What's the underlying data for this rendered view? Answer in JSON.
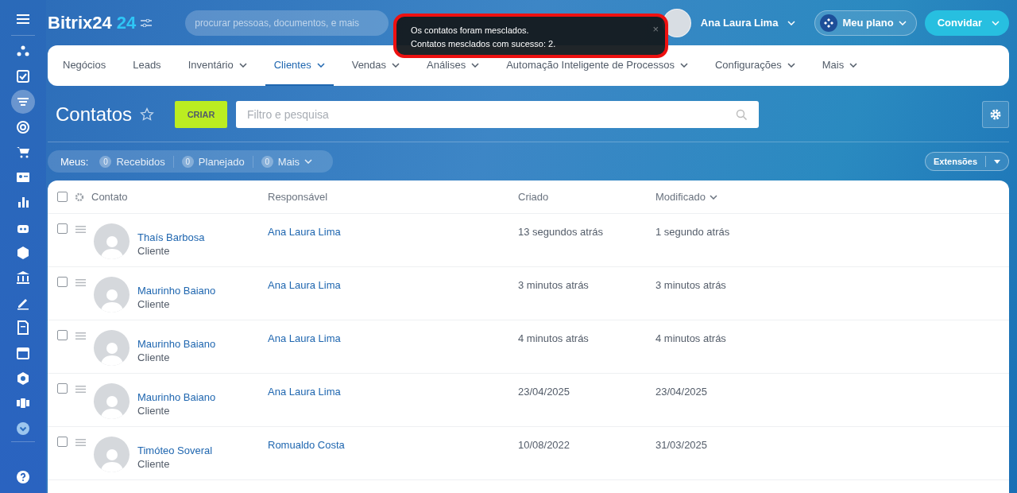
{
  "header": {
    "logo": "Bitrix24",
    "logo_badge": "24",
    "search_placeholder": "procurar pessoas, documentos, e mais",
    "user_name": "Ana Laura Lima",
    "plan_button": "Meu plano",
    "invite_button": "Convidar"
  },
  "toast": {
    "lines": [
      "Os contatos foram mesclados.",
      "Contatos mesclados com sucesso: 2."
    ],
    "close": "×"
  },
  "sidebar": {
    "items": [
      {
        "kind": "feed",
        "selected": false
      },
      {
        "kind": "tasks",
        "selected": false
      },
      {
        "kind": "filter",
        "selected": true
      },
      {
        "kind": "target",
        "selected": false
      },
      {
        "kind": "cart",
        "selected": false
      },
      {
        "kind": "card",
        "selected": false
      },
      {
        "kind": "chart",
        "selected": false
      },
      {
        "kind": "robot",
        "selected": false
      },
      {
        "kind": "box",
        "selected": false
      },
      {
        "kind": "bank",
        "selected": false
      },
      {
        "kind": "pen",
        "selected": false
      },
      {
        "kind": "doc",
        "selected": false
      },
      {
        "kind": "calendar",
        "selected": false
      },
      {
        "kind": "shield",
        "selected": false
      },
      {
        "kind": "sites",
        "selected": false
      },
      {
        "kind": "more",
        "selected": false
      }
    ]
  },
  "nav": [
    {
      "label": "Negócios",
      "selected": false,
      "dropdown": false
    },
    {
      "label": "Leads",
      "selected": false,
      "dropdown": false
    },
    {
      "label": "Inventário",
      "selected": false,
      "dropdown": true
    },
    {
      "label": "Clientes",
      "selected": true,
      "dropdown": true
    },
    {
      "label": "Vendas",
      "selected": false,
      "dropdown": true
    },
    {
      "label": "Análises",
      "selected": false,
      "dropdown": true
    },
    {
      "label": "Automação Inteligente de Processos",
      "selected": false,
      "dropdown": true
    },
    {
      "label": "Configurações",
      "selected": false,
      "dropdown": true
    },
    {
      "label": "Mais",
      "selected": false,
      "dropdown": true
    }
  ],
  "page": {
    "title": "Contatos",
    "create_button": "CRIAR",
    "filter_placeholder": "Filtro e pesquisa"
  },
  "counters": {
    "label": "Meus:",
    "items": [
      {
        "count": "0",
        "label": "Recebidos",
        "dropdown": false
      },
      {
        "count": "0",
        "label": "Planejado",
        "dropdown": false
      },
      {
        "count": "0",
        "label": "Mais",
        "dropdown": true
      }
    ]
  },
  "extensions_button": "Extensões",
  "table": {
    "all_checked": false,
    "columns": [
      {
        "label": "Contato",
        "sorted": false
      },
      {
        "label": "Responsável",
        "sorted": false
      },
      {
        "label": "Criado",
        "sorted": false
      },
      {
        "label": "Modificado",
        "sorted": true
      }
    ],
    "rows": [
      {
        "name": "Thaís Barbosa",
        "type": "Cliente",
        "responsible": "Ana Laura Lima",
        "created": "13 segundos atrás",
        "modified": "1 segundo atrás",
        "checked": false
      },
      {
        "name": "Maurinho Baiano",
        "type": "Cliente",
        "responsible": "Ana Laura Lima",
        "created": "3 minutos atrás",
        "modified": "3 minutos atrás",
        "checked": false
      },
      {
        "name": "Maurinho Baiano",
        "type": "Cliente",
        "responsible": "Ana Laura Lima",
        "created": "4 minutos atrás",
        "modified": "4 minutos atrás",
        "checked": false
      },
      {
        "name": "Maurinho Baiano",
        "type": "Cliente",
        "responsible": "Ana Laura Lima",
        "created": "23/04/2025",
        "modified": "23/04/2025",
        "checked": false
      },
      {
        "name": "Timóteo Soveral",
        "type": "Cliente",
        "responsible": "Romualdo Costa",
        "created": "10/08/2022",
        "modified": "31/03/2025",
        "checked": false
      }
    ]
  }
}
